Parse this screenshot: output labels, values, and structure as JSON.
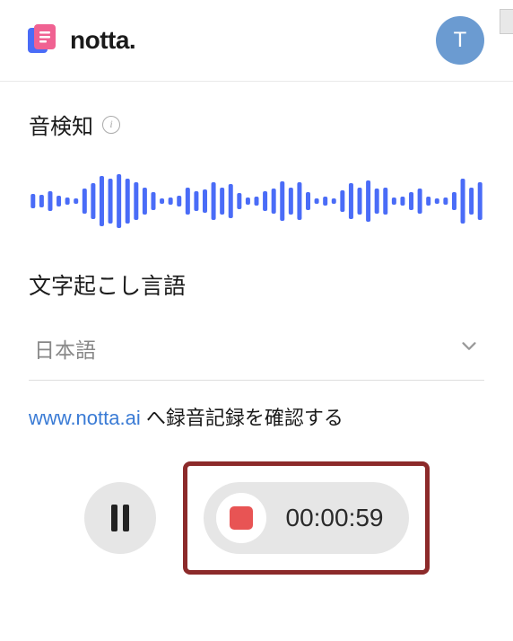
{
  "header": {
    "brand": "notta.",
    "avatar_initial": "T"
  },
  "sound_detection": {
    "title": "音検知"
  },
  "language": {
    "title": "文字起こし言語",
    "selected": "日本語"
  },
  "link": {
    "url_text": "www.notta.ai",
    "suffix": " へ録音記録を確認する"
  },
  "recorder": {
    "timer": "00:00:59"
  },
  "waveform": {
    "bars": [
      16,
      14,
      22,
      12,
      8,
      6,
      28,
      40,
      56,
      50,
      60,
      50,
      42,
      30,
      20,
      6,
      8,
      12,
      30,
      22,
      26,
      42,
      30,
      38,
      18,
      8,
      10,
      22,
      28,
      44,
      30,
      42,
      20,
      6,
      10,
      6,
      24,
      40,
      30,
      46,
      28,
      30,
      8,
      10,
      20,
      28,
      10,
      6,
      8,
      20,
      50,
      30,
      42
    ]
  }
}
